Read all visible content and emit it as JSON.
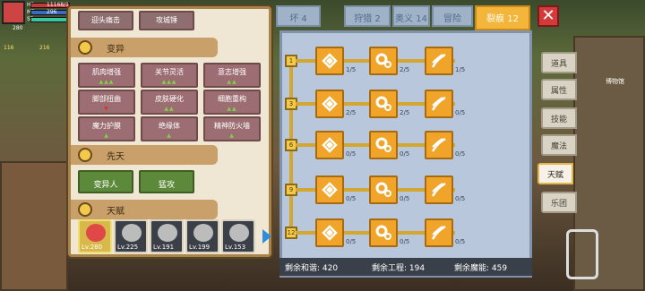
{
  "hud": {
    "hp_label": "HP",
    "hp_value": "11168/1",
    "mp_label": "MP",
    "mp_value": "296",
    "sp_label": "SP",
    "level_badge": "280",
    "coins1": "116",
    "coins2": "216",
    "building": "博物馆"
  },
  "left_panel": {
    "skills_top": [
      {
        "label": "迎头痛击"
      },
      {
        "label": "攻城锤"
      }
    ],
    "mutation": {
      "title": "变异",
      "items": [
        {
          "label": "肌肉增强",
          "arrows": "▲▲▲"
        },
        {
          "label": "关节灵活",
          "arrows": "▲▲▲"
        },
        {
          "label": "意志增强",
          "arrows": "▲▲"
        },
        {
          "label": "脚部扭曲",
          "arrows": "▼"
        },
        {
          "label": "皮肤硬化",
          "arrows": "▲▲"
        },
        {
          "label": "细胞重构",
          "arrows": "▲▲"
        },
        {
          "label": "魔力护膜",
          "arrows": "▲"
        },
        {
          "label": "绝缘体",
          "arrows": "▲"
        },
        {
          "label": "精神防火墙",
          "arrows": "▲"
        }
      ]
    },
    "innate": {
      "title": "先天",
      "items": [
        {
          "label": "变异人"
        },
        {
          "label": "猛攻"
        }
      ]
    },
    "talent": {
      "title": "天赋"
    },
    "heroes": [
      {
        "lv": "Lv.280"
      },
      {
        "lv": "Lv.225"
      },
      {
        "lv": "Lv.191"
      },
      {
        "lv": "Lv.199"
      },
      {
        "lv": "Lv.153"
      }
    ]
  },
  "tabs": [
    {
      "label": "坏 4"
    },
    {
      "label": "狩猎 2"
    },
    {
      "label": "奥义 14"
    },
    {
      "label": "冒险"
    },
    {
      "label": "裂痕 12"
    }
  ],
  "close_icon": "close-icon",
  "levels": [
    "1",
    "3",
    "6",
    "9",
    "12"
  ],
  "nodes": [
    [
      "1/5",
      "2/5",
      "1/5"
    ],
    [
      "2/5",
      "2/5",
      "0/5"
    ],
    [
      "0/5",
      "0/5",
      "0/5"
    ],
    [
      "0/5",
      "0/5",
      "0/5"
    ],
    [
      "0/5",
      "0/5",
      "0/5"
    ]
  ],
  "footer": {
    "a": "剩余和谐: 420",
    "b": "剩余工程: 194",
    "c": "剩余魔能: 459"
  },
  "side_menu": [
    {
      "label": "道具"
    },
    {
      "label": "属性"
    },
    {
      "label": "技能"
    },
    {
      "label": "魔法"
    },
    {
      "label": "天赋"
    },
    {
      "label": "乐团"
    }
  ],
  "colors": {
    "node": "#f0a52a",
    "board": "#b8c7db",
    "active_tab": "#f3b53a",
    "panel": "#efe7d4"
  }
}
